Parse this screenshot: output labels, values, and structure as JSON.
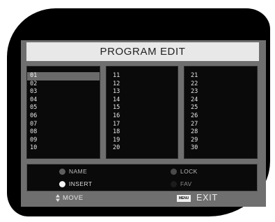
{
  "title": "PROGRAM EDIT",
  "columns": [
    {
      "items": [
        "01",
        "02",
        "03",
        "04",
        "05",
        "06",
        "07",
        "08",
        "09",
        "10"
      ]
    },
    {
      "items": [
        "11",
        "12",
        "13",
        "14",
        "15",
        "16",
        "17",
        "18",
        "19",
        "20"
      ]
    },
    {
      "items": [
        "21",
        "22",
        "23",
        "24",
        "25",
        "26",
        "27",
        "28",
        "29",
        "30"
      ]
    }
  ],
  "selected_item": "01",
  "legend": {
    "name": {
      "label": "NAME",
      "color": "#5e5e5e"
    },
    "lock": {
      "label": "LOCK",
      "color": "#4a4a4a"
    },
    "insert": {
      "label": "INSERT",
      "color": "#f2f2f2"
    },
    "fav": {
      "label": "FAV",
      "color": "#1c1c1c"
    }
  },
  "footer": {
    "move_icon": "up-down-arrows-icon",
    "move_label": "MOVE",
    "menu_key_label": "MENU",
    "exit_label": "EXIT"
  }
}
